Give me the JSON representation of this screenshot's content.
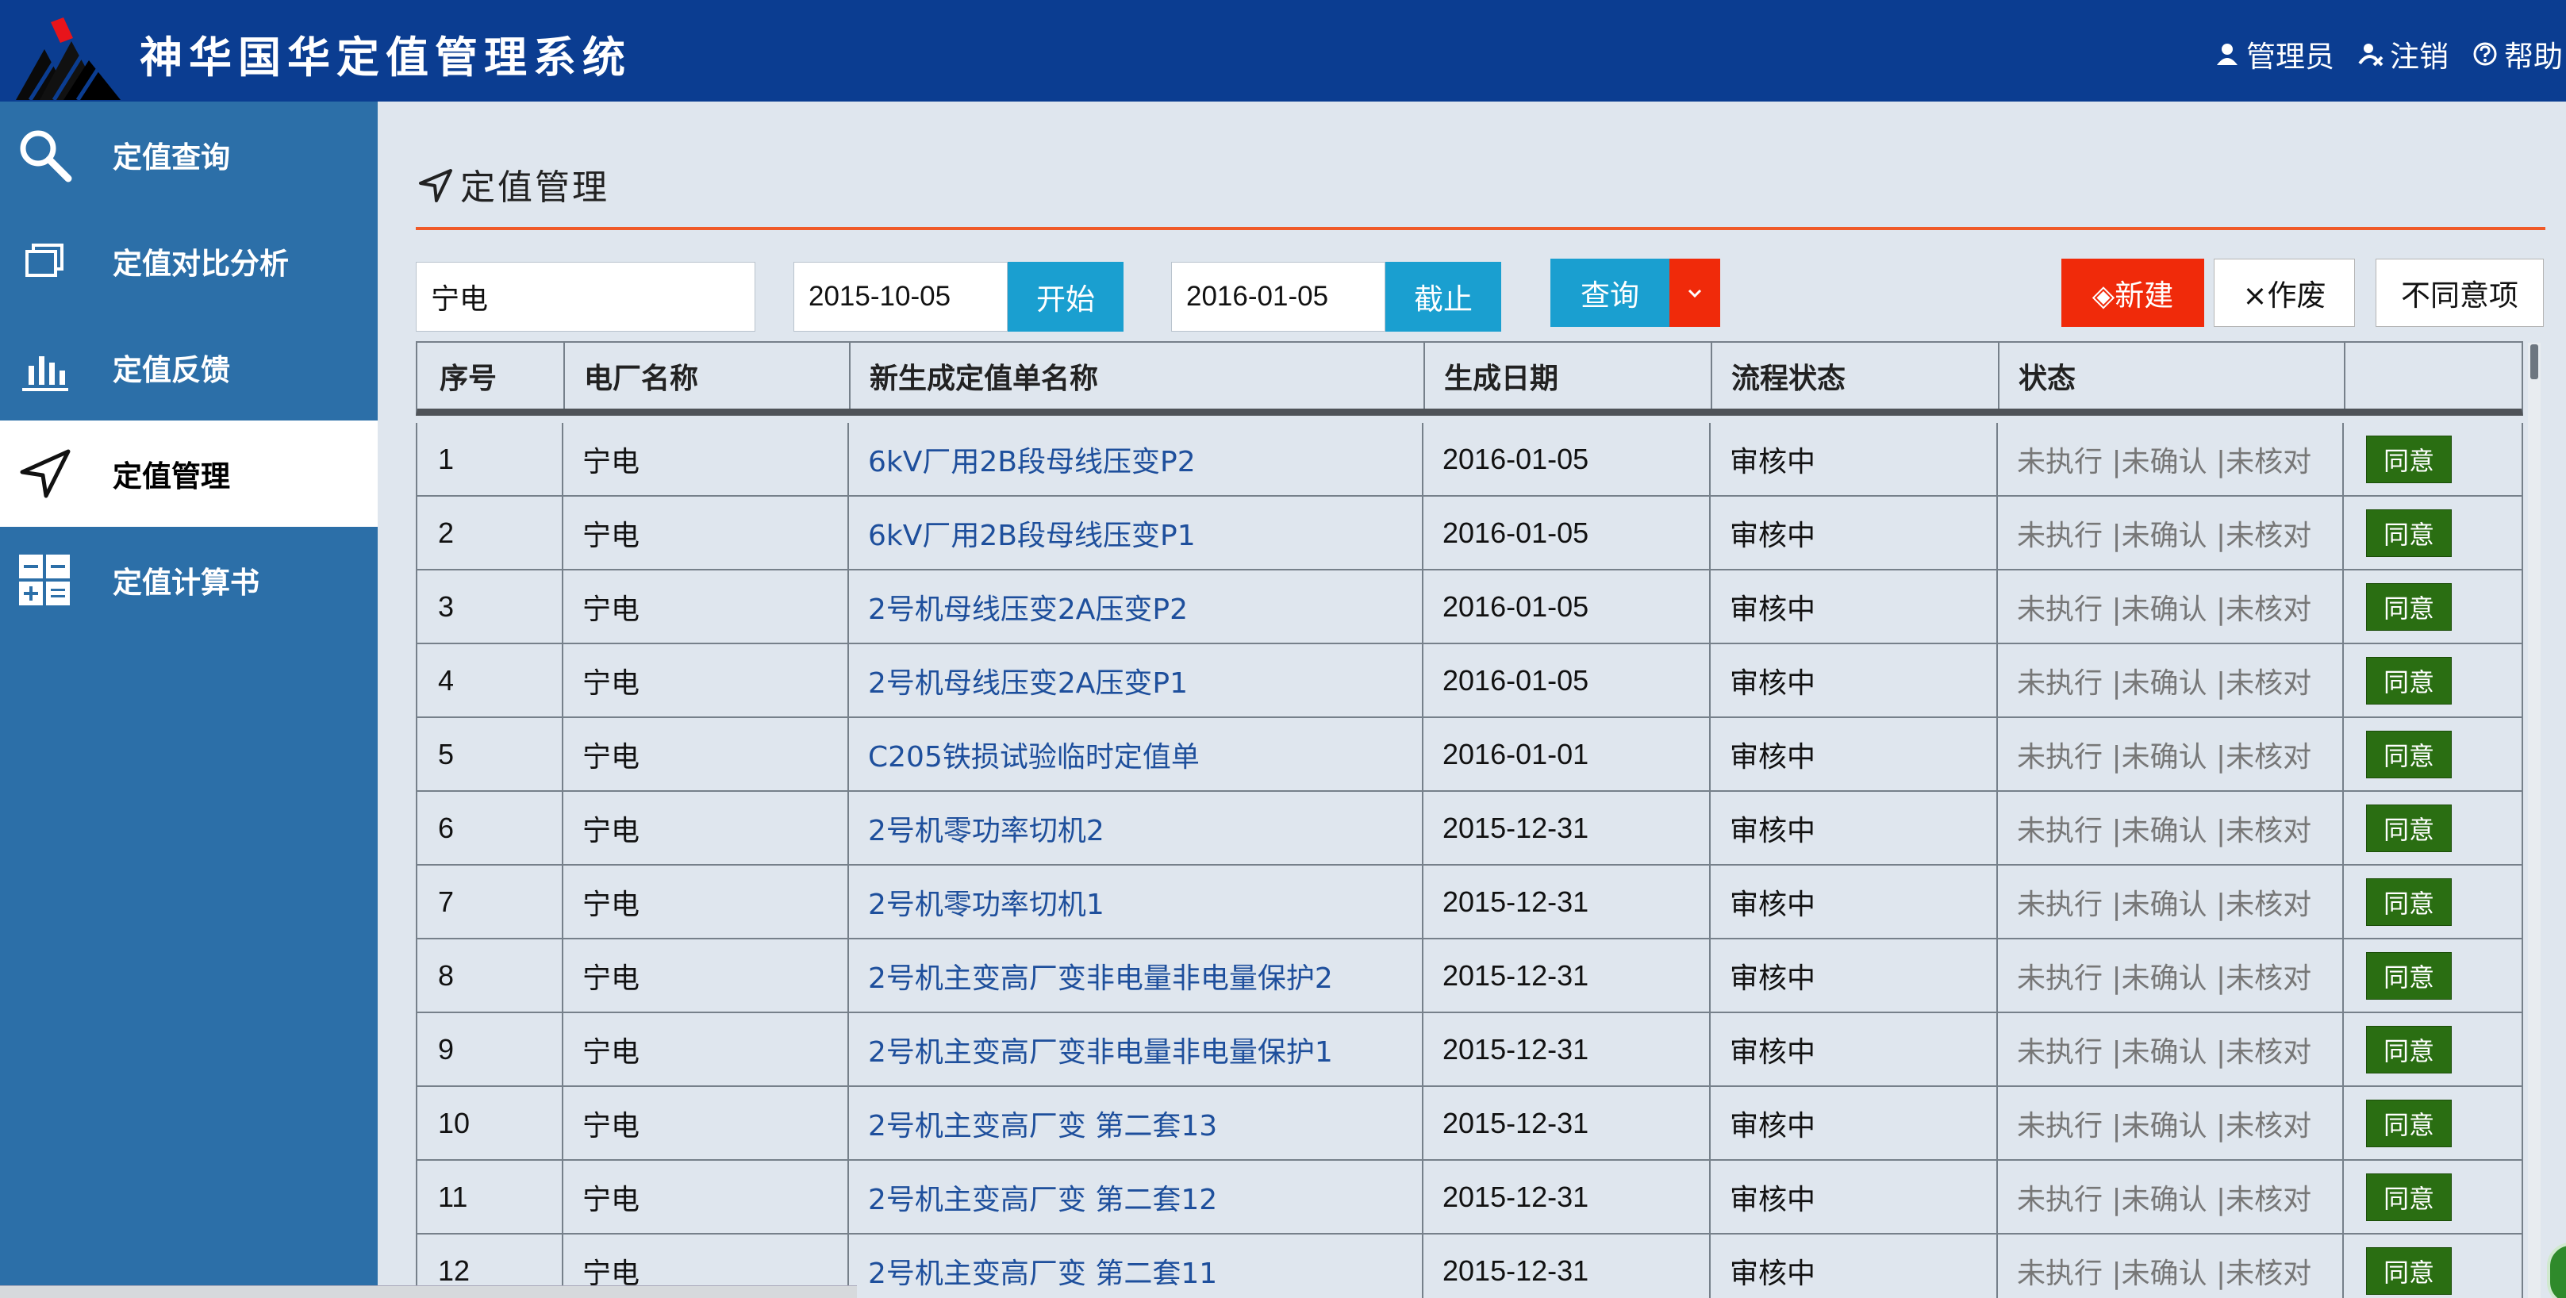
{
  "header": {
    "title": "神华国华定值管理系统",
    "nav": [
      {
        "label": "管理员",
        "icon": "user-icon"
      },
      {
        "label": "注销",
        "icon": "logout-icon"
      },
      {
        "label": "帮助",
        "icon": "help-icon"
      }
    ]
  },
  "sidebar": {
    "items": [
      {
        "label": "定值查询",
        "icon": "search-icon",
        "active": false
      },
      {
        "label": "定值对比分析",
        "icon": "copy-icon",
        "active": false
      },
      {
        "label": "定值反馈",
        "icon": "bar-chart-icon",
        "active": false
      },
      {
        "label": "定值管理",
        "icon": "navigation-arrow-icon",
        "active": true
      },
      {
        "label": "定值计算书",
        "icon": "calculator-icon",
        "active": false
      }
    ]
  },
  "page": {
    "breadcrumb": "定值管理"
  },
  "filters": {
    "plant_value": "宁电",
    "start_date": "2015-10-05",
    "start_label": "开始",
    "end_date": "2016-01-05",
    "end_label": "截止",
    "query_label": "查询",
    "new_label": "◈新建",
    "void_label": "⨯作废",
    "disagree_label": "不同意项"
  },
  "table": {
    "headers": [
      "序号",
      "电厂名称",
      "新生成定值单名称",
      "生成日期",
      "流程状态",
      "状态",
      ""
    ],
    "rows": [
      {
        "no": "1",
        "plant": "宁电",
        "name": "6kV厂用2B段母线压变P2",
        "date": "2016-01-05",
        "flow": "审核中",
        "status": "未执行 |未确认 |未核对",
        "action": "同意"
      },
      {
        "no": "2",
        "plant": "宁电",
        "name": "6kV厂用2B段母线压变P1",
        "date": "2016-01-05",
        "flow": "审核中",
        "status": "未执行 |未确认 |未核对",
        "action": "同意"
      },
      {
        "no": "3",
        "plant": "宁电",
        "name": "2号机母线压变2A压变P2",
        "date": "2016-01-05",
        "flow": "审核中",
        "status": "未执行 |未确认 |未核对",
        "action": "同意"
      },
      {
        "no": "4",
        "plant": "宁电",
        "name": "2号机母线压变2A压变P1",
        "date": "2016-01-05",
        "flow": "审核中",
        "status": "未执行 |未确认 |未核对",
        "action": "同意"
      },
      {
        "no": "5",
        "plant": "宁电",
        "name": "C205铁损试验临时定值单",
        "date": "2016-01-01",
        "flow": "审核中",
        "status": "未执行 |未确认 |未核对",
        "action": "同意"
      },
      {
        "no": "6",
        "plant": "宁电",
        "name": "2号机零功率切机2",
        "date": "2015-12-31",
        "flow": "审核中",
        "status": "未执行 |未确认 |未核对",
        "action": "同意"
      },
      {
        "no": "7",
        "plant": "宁电",
        "name": "2号机零功率切机1",
        "date": "2015-12-31",
        "flow": "审核中",
        "status": "未执行 |未确认 |未核对",
        "action": "同意"
      },
      {
        "no": "8",
        "plant": "宁电",
        "name": "2号机主变高厂变非电量非电量保护2",
        "date": "2015-12-31",
        "flow": "审核中",
        "status": "未执行 |未确认 |未核对",
        "action": "同意"
      },
      {
        "no": "9",
        "plant": "宁电",
        "name": "2号机主变高厂变非电量非电量保护1",
        "date": "2015-12-31",
        "flow": "审核中",
        "status": "未执行 |未确认 |未核对",
        "action": "同意"
      },
      {
        "no": "10",
        "plant": "宁电",
        "name": "2号机主变高厂变 第二套13",
        "date": "2015-12-31",
        "flow": "审核中",
        "status": "未执行 |未确认 |未核对",
        "action": "同意"
      },
      {
        "no": "11",
        "plant": "宁电",
        "name": "2号机主变高厂变 第二套12",
        "date": "2015-12-31",
        "flow": "审核中",
        "status": "未执行 |未确认 |未核对",
        "action": "同意"
      },
      {
        "no": "12",
        "plant": "宁电",
        "name": "2号机主变高厂变 第二套11",
        "date": "2015-12-31",
        "flow": "审核中",
        "status": "未执行 |未确认 |未核对",
        "action": "同意"
      }
    ]
  },
  "colors": {
    "header_bg": "#0b3d91",
    "sidebar_bg": "#2c6fa8",
    "accent_orange": "#f05a28",
    "button_blue": "#1a9fd0",
    "button_red": "#f02a0a",
    "agree_green": "#2a6e12",
    "link_blue": "#1e4f9c"
  }
}
